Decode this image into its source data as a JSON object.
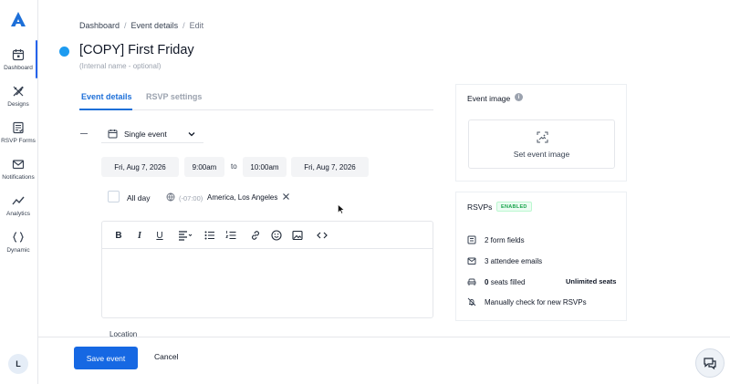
{
  "sidebar": {
    "items": [
      {
        "label": "Dashboard",
        "icon": "calendar-icon",
        "active": true
      },
      {
        "label": "Designs",
        "icon": "brush-icon",
        "active": false
      },
      {
        "label": "RSVP Forms",
        "icon": "form-icon",
        "active": false
      },
      {
        "label": "Notifications",
        "icon": "mail-icon",
        "active": false
      },
      {
        "label": "Analytics",
        "icon": "chart-icon",
        "active": false
      },
      {
        "label": "Dynamic",
        "icon": "braces-icon",
        "active": false
      }
    ],
    "avatar_initial": "L"
  },
  "breadcrumb": {
    "items": [
      "Dashboard",
      "Event details",
      "Edit"
    ],
    "separator": "/"
  },
  "header": {
    "title": "[COPY] First Friday",
    "status_color": "#1d9bf0",
    "internal_name_placeholder": "(Internal name - optional)"
  },
  "tabs": [
    {
      "label": "Event details",
      "active": true
    },
    {
      "label": "RSVP settings",
      "active": false
    }
  ],
  "event": {
    "type": "Single event",
    "start_date": "Fri, Aug 7, 2026",
    "start_time": "9:00am",
    "to_label": "to",
    "end_time": "10:00am",
    "end_date": "Fri, Aug 7, 2026",
    "all_day_label": "All day",
    "all_day_checked": false,
    "timezone_offset": "(-07:00)",
    "timezone_name": "America, Los Angeles",
    "location_label": "Location"
  },
  "editor_toolbar": [
    "bold",
    "italic",
    "underline",
    "align",
    "bullet-list",
    "numbered-list",
    "link",
    "emoji",
    "image",
    "code"
  ],
  "event_image": {
    "title": "Event image",
    "action_label": "Set event image"
  },
  "rsvps": {
    "title": "RSVPs",
    "badge": "ENABLED",
    "form_fields": "2 form fields",
    "attendee_emails": "3 attendee emails",
    "seats_count": "0",
    "seats_label": "seats filled",
    "unlimited": "Unlimited seats",
    "manual_check": "Manually check for new RSVPs"
  },
  "footer": {
    "save_label": "Save event",
    "cancel_label": "Cancel"
  },
  "colors": {
    "accent": "#1668e3",
    "enabled_badge": "#16a34a"
  }
}
